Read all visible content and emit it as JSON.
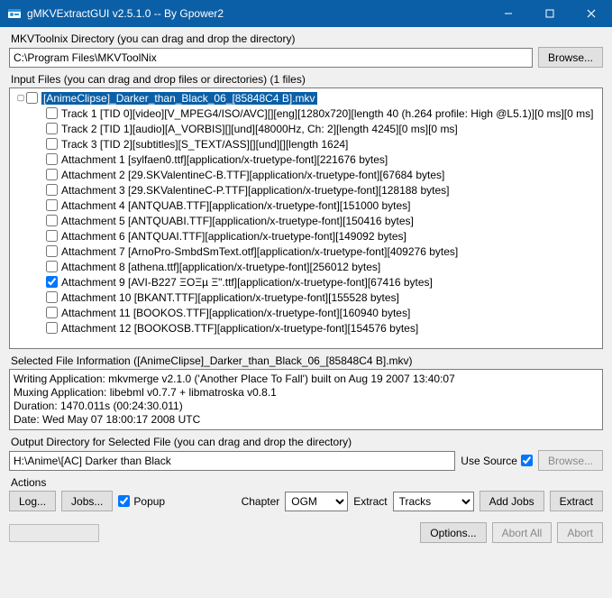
{
  "window": {
    "title": "gMKVExtractGUI v2.5.1.0 -- By Gpower2"
  },
  "mkvtoolnix": {
    "group_label": "MKVToolnix Directory (you can drag and drop the directory)",
    "path": "C:\\Program Files\\MKVToolNix",
    "browse_label": "Browse..."
  },
  "input": {
    "group_label": "Input Files (you can drag and drop files or directories) (1 files)",
    "root_label": "[AnimeClipse]_Darker_than_Black_06_[85848C4 B].mkv",
    "items": [
      {
        "checked": false,
        "label": "Track 1 [TID 0][video][V_MPEG4/ISO/AVC][][eng][1280x720][length 40 (h.264 profile: High @L5.1)][0 ms][0 ms]"
      },
      {
        "checked": false,
        "label": "Track 2 [TID 1][audio][A_VORBIS][][und][48000Hz, Ch: 2][length 4245][0 ms][0 ms]"
      },
      {
        "checked": false,
        "label": "Track 3 [TID 2][subtitles][S_TEXT/ASS][][und][][length 1624]"
      },
      {
        "checked": false,
        "label": "Attachment 1 [sylfaen0.ttf][application/x-truetype-font][221676 bytes]"
      },
      {
        "checked": false,
        "label": "Attachment 2 [29.SKValentineC-B.TTF][application/x-truetype-font][67684 bytes]"
      },
      {
        "checked": false,
        "label": "Attachment 3 [29.SKValentineC-P.TTF][application/x-truetype-font][128188 bytes]"
      },
      {
        "checked": false,
        "label": "Attachment 4 [ANTQUAB.TTF][application/x-truetype-font][151000 bytes]"
      },
      {
        "checked": false,
        "label": "Attachment 5 [ANTQUABI.TTF][application/x-truetype-font][150416 bytes]"
      },
      {
        "checked": false,
        "label": "Attachment 6 [ANTQUAI.TTF][application/x-truetype-font][149092 bytes]"
      },
      {
        "checked": false,
        "label": "Attachment 7 [ArnoPro-SmbdSmText.otf][application/x-truetype-font][409276 bytes]"
      },
      {
        "checked": false,
        "label": "Attachment 8 [athena.ttf][application/x-truetype-font][256012 bytes]"
      },
      {
        "checked": true,
        "label": "Attachment 9 [AVI-B227 ΞΟΞµ Ξ\".ttf][application/x-truetype-font][67416 bytes]"
      },
      {
        "checked": false,
        "label": "Attachment 10 [BKANT.TTF][application/x-truetype-font][155528 bytes]"
      },
      {
        "checked": false,
        "label": "Attachment 11 [BOOKOS.TTF][application/x-truetype-font][160940 bytes]"
      },
      {
        "checked": false,
        "label": "Attachment 12 [BOOKOSB.TTF][application/x-truetype-font][154576 bytes]"
      }
    ]
  },
  "fileinfo": {
    "group_label": "Selected File Information ([AnimeClipse]_Darker_than_Black_06_[85848C4 B].mkv)",
    "line1": "Writing Application: mkvmerge v2.1.0 ('Another Place To Fall') built on Aug 19 2007 13:40:07",
    "line2": "Muxing Application: libebml v0.7.7 + libmatroska v0.8.1",
    "line3": "Duration: 1470.011s (00:24:30.011)",
    "line4": "Date: Wed May 07 18:00:17 2008 UTC"
  },
  "output": {
    "group_label": "Output Directory for Selected File (you can drag and drop the directory)",
    "path": "H:\\Anime\\[AC] Darker than Black",
    "use_source_label": "Use Source",
    "use_source_checked": true,
    "browse_label": "Browse..."
  },
  "actions": {
    "group_label": "Actions",
    "log_label": "Log...",
    "jobs_label": "Jobs...",
    "popup_label": "Popup",
    "popup_checked": true,
    "chapter_label": "Chapter",
    "chapter_value": "OGM",
    "extract_label": "Extract",
    "extract_value": "Tracks",
    "add_jobs_label": "Add Jobs",
    "extract_btn_label": "Extract"
  },
  "bottom": {
    "options_label": "Options...",
    "abort_all_label": "Abort All",
    "abort_label": "Abort"
  }
}
